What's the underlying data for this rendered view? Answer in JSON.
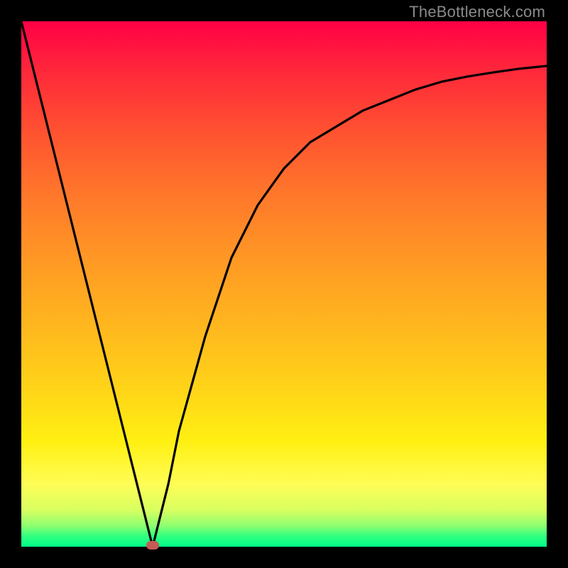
{
  "watermark": "TheBottleneck.com",
  "colors": {
    "frame": "#000000",
    "curve": "#000000",
    "marker": "#c65a55"
  },
  "chart_data": {
    "type": "line",
    "title": "",
    "xlabel": "",
    "ylabel": "",
    "xlim": [
      0,
      100
    ],
    "ylim": [
      0,
      100
    ],
    "grid": false,
    "series": [
      {
        "name": "bottleneck-curve",
        "x": [
          0,
          5,
          10,
          15,
          20,
          22,
          24,
          25,
          26,
          28,
          30,
          35,
          40,
          45,
          50,
          55,
          60,
          65,
          70,
          75,
          80,
          85,
          90,
          95,
          100
        ],
        "values": [
          100,
          80,
          60,
          40,
          20,
          12,
          4,
          0,
          4,
          12,
          22,
          40,
          55,
          65,
          72,
          77,
          80,
          83,
          85,
          87,
          88.5,
          89.5,
          90.3,
          91,
          91.5
        ]
      }
    ],
    "annotations": [
      {
        "name": "minimum-marker",
        "x": 25,
        "y": 0
      }
    ],
    "background_gradient": {
      "top": "#ff0046",
      "mid": "#fff012",
      "bottom": "#00ff88"
    }
  }
}
